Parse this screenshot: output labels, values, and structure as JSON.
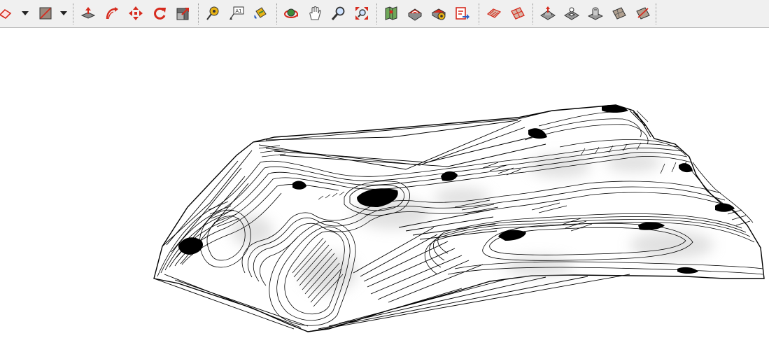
{
  "toolbar": {
    "colors": {
      "accent_red": "#d62b1e",
      "model_gray": "#8c8c8c",
      "tool_green": "#3d8a3a",
      "tool_blue": "#2b5fc4",
      "tool_yellow": "#e8b316"
    },
    "buttons": [
      {
        "name": "eraser-tool-button",
        "icon": "eraser-icon"
      },
      {
        "name": "shapes-dropdown",
        "icon": "dropdown-arrow-icon"
      },
      {
        "name": "rectangle-tool-button",
        "icon": "rectangle-icon"
      },
      {
        "name": "rectangle-dropdown",
        "icon": "dropdown-arrow-icon"
      },
      {
        "name": "push-pull-tool-button",
        "icon": "push-pull-icon"
      },
      {
        "name": "follow-me-tool-button",
        "icon": "follow-me-icon"
      },
      {
        "name": "move-tool-button",
        "icon": "move-icon"
      },
      {
        "name": "rotate-tool-button",
        "icon": "rotate-icon"
      },
      {
        "name": "scale-tool-button",
        "icon": "scale-icon"
      },
      {
        "name": "tape-measure-tool-button",
        "icon": "tape-measure-icon"
      },
      {
        "name": "text-tool-button",
        "icon": "text-icon"
      },
      {
        "name": "paint-bucket-tool-button",
        "icon": "paint-bucket-icon"
      },
      {
        "name": "orbit-tool-button",
        "icon": "orbit-icon"
      },
      {
        "name": "pan-tool-button",
        "icon": "pan-hand-icon"
      },
      {
        "name": "zoom-tool-button",
        "icon": "zoom-icon"
      },
      {
        "name": "zoom-extents-button",
        "icon": "zoom-extents-icon"
      },
      {
        "name": "add-location-button",
        "icon": "add-location-icon"
      },
      {
        "name": "3d-warehouse-button",
        "icon": "warehouse-icon"
      },
      {
        "name": "extension-warehouse-button",
        "icon": "extension-icon"
      },
      {
        "name": "share-model-button",
        "icon": "share-model-icon"
      },
      {
        "name": "sandbox-from-contours-button",
        "icon": "from-contours-icon"
      },
      {
        "name": "sandbox-from-scratch-button",
        "icon": "from-scratch-icon"
      },
      {
        "name": "smoove-button",
        "icon": "smoove-icon"
      },
      {
        "name": "stamp-button",
        "icon": "stamp-icon"
      },
      {
        "name": "drape-button",
        "icon": "drape-icon"
      },
      {
        "name": "add-detail-button",
        "icon": "add-detail-icon"
      },
      {
        "name": "flip-edge-button",
        "icon": "flip-edge-icon"
      }
    ]
  },
  "viewport": {
    "content": "terrain-mesh-model",
    "colors": {
      "edge": "#000000",
      "face": "#ffffff",
      "shade": "#c9c9c9"
    }
  }
}
